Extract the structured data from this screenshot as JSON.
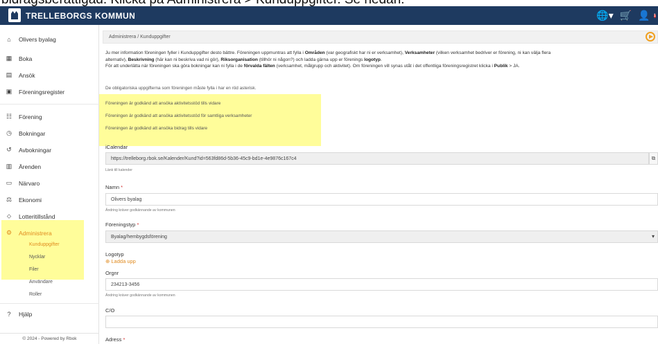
{
  "doc_top_text": "bidragsberättigad. Klicka på Administrera > Kunduppgifter. Se nedan.",
  "header": {
    "brand": "TRELLEBORGS KOMMUN",
    "icons": [
      "globe-icon",
      "cart-icon",
      "user-icon"
    ],
    "cart_badge": "1"
  },
  "sidebar": {
    "account": "Olivers byalag",
    "items": [
      {
        "label": "Boka"
      },
      {
        "label": "Ansök"
      },
      {
        "label": "Föreningsregister"
      },
      {
        "label": "Förening"
      },
      {
        "label": "Bokningar"
      },
      {
        "label": "Avbokningar"
      },
      {
        "label": "Ärenden"
      },
      {
        "label": "Närvaro"
      },
      {
        "label": "Ekonomi"
      },
      {
        "label": "Lotteritillstånd"
      },
      {
        "label": "Administrera"
      }
    ],
    "subitems": [
      {
        "label": "Kunduppgifter"
      },
      {
        "label": "Nycklar"
      },
      {
        "label": "Filer"
      },
      {
        "label": "Användare"
      },
      {
        "label": "Roller"
      }
    ],
    "help": "Hjälp",
    "footer": "© 2024 - Powered by Rbok"
  },
  "breadcrumb": "Administrera / Kunduppgifter",
  "intro": {
    "p1_a": "Ju mer information föreningen fyller i Kunduppgifter desto bättre. Föreningen uppmuntras att fylla i ",
    "p1_b": "Områden",
    "p1_c": " (var geografiskt har ni er verksamhet), ",
    "p1_d": "Verksamheter",
    "p1_e": " (vilken verksamhet bedriver er förening, ni kan välja flera",
    "p2_a": "alternativ), ",
    "p2_b": "Beskrivning",
    "p2_c": " (här kan ni beskriva vad ni gör), ",
    "p2_d": "Riksorganisation",
    "p2_e": " (tillhör ni någon?) och ladda gärna upp er förenings ",
    "p2_f": "logotyp",
    "p2_g": ".",
    "p3_a": "För att underlätta när föreningen ska göra bokningar kan ni fylla i de ",
    "p3_b": "förvalda fälten",
    "p3_c": " (verksamhet, målgrupp och aktivitet). Om föreningen vill synas utåt i det offentliga föreningsregistret klicka i ",
    "p3_d": "Publik",
    "p3_e": " > JA."
  },
  "notices": {
    "mandatory": "De obligatoriska uppgifterna som föreningen måste fylla i har en röd asterisk.",
    "approved_1": "Föreningen är godkänd att ansöka aktivitetsstöd tills vidare",
    "approved_2": "Föreningen är godkänd att ansöka aktivitetsstöd för samtliga verksamheter",
    "approved_3": "Föreningen är godkänd att ansöka bidrag tills vidare"
  },
  "form": {
    "icalendar_label": "iCalendar",
    "icalendar_value": "https://trelleborg.rbok.se/Kalender/Kund?id=563fd86d-5b36-45c9-bd1e-4e9876c167c4",
    "icalendar_hint": "Länk till kalender",
    "name_label": "Namn",
    "name_value": "Olivers byalag",
    "name_hint": "Ändring kräver godkännande av kommunen",
    "type_label": "Föreningstyp",
    "type_value": "Byalag/hembygdsförening",
    "logo_label": "Logotyp",
    "upload_label": "Ladda upp",
    "orgnr_label": "Orgnr",
    "orgnr_value": "234213-3456",
    "orgnr_hint": "Ändring kräver godkännande av kommunen",
    "co_label": "C/O",
    "co_value": "",
    "address_label": "Adress",
    "required_mark": "*"
  },
  "colors": {
    "header": "#1e3a60",
    "accent": "#e08a1e",
    "highlight": "#fffc78",
    "required": "#d32f2f"
  }
}
